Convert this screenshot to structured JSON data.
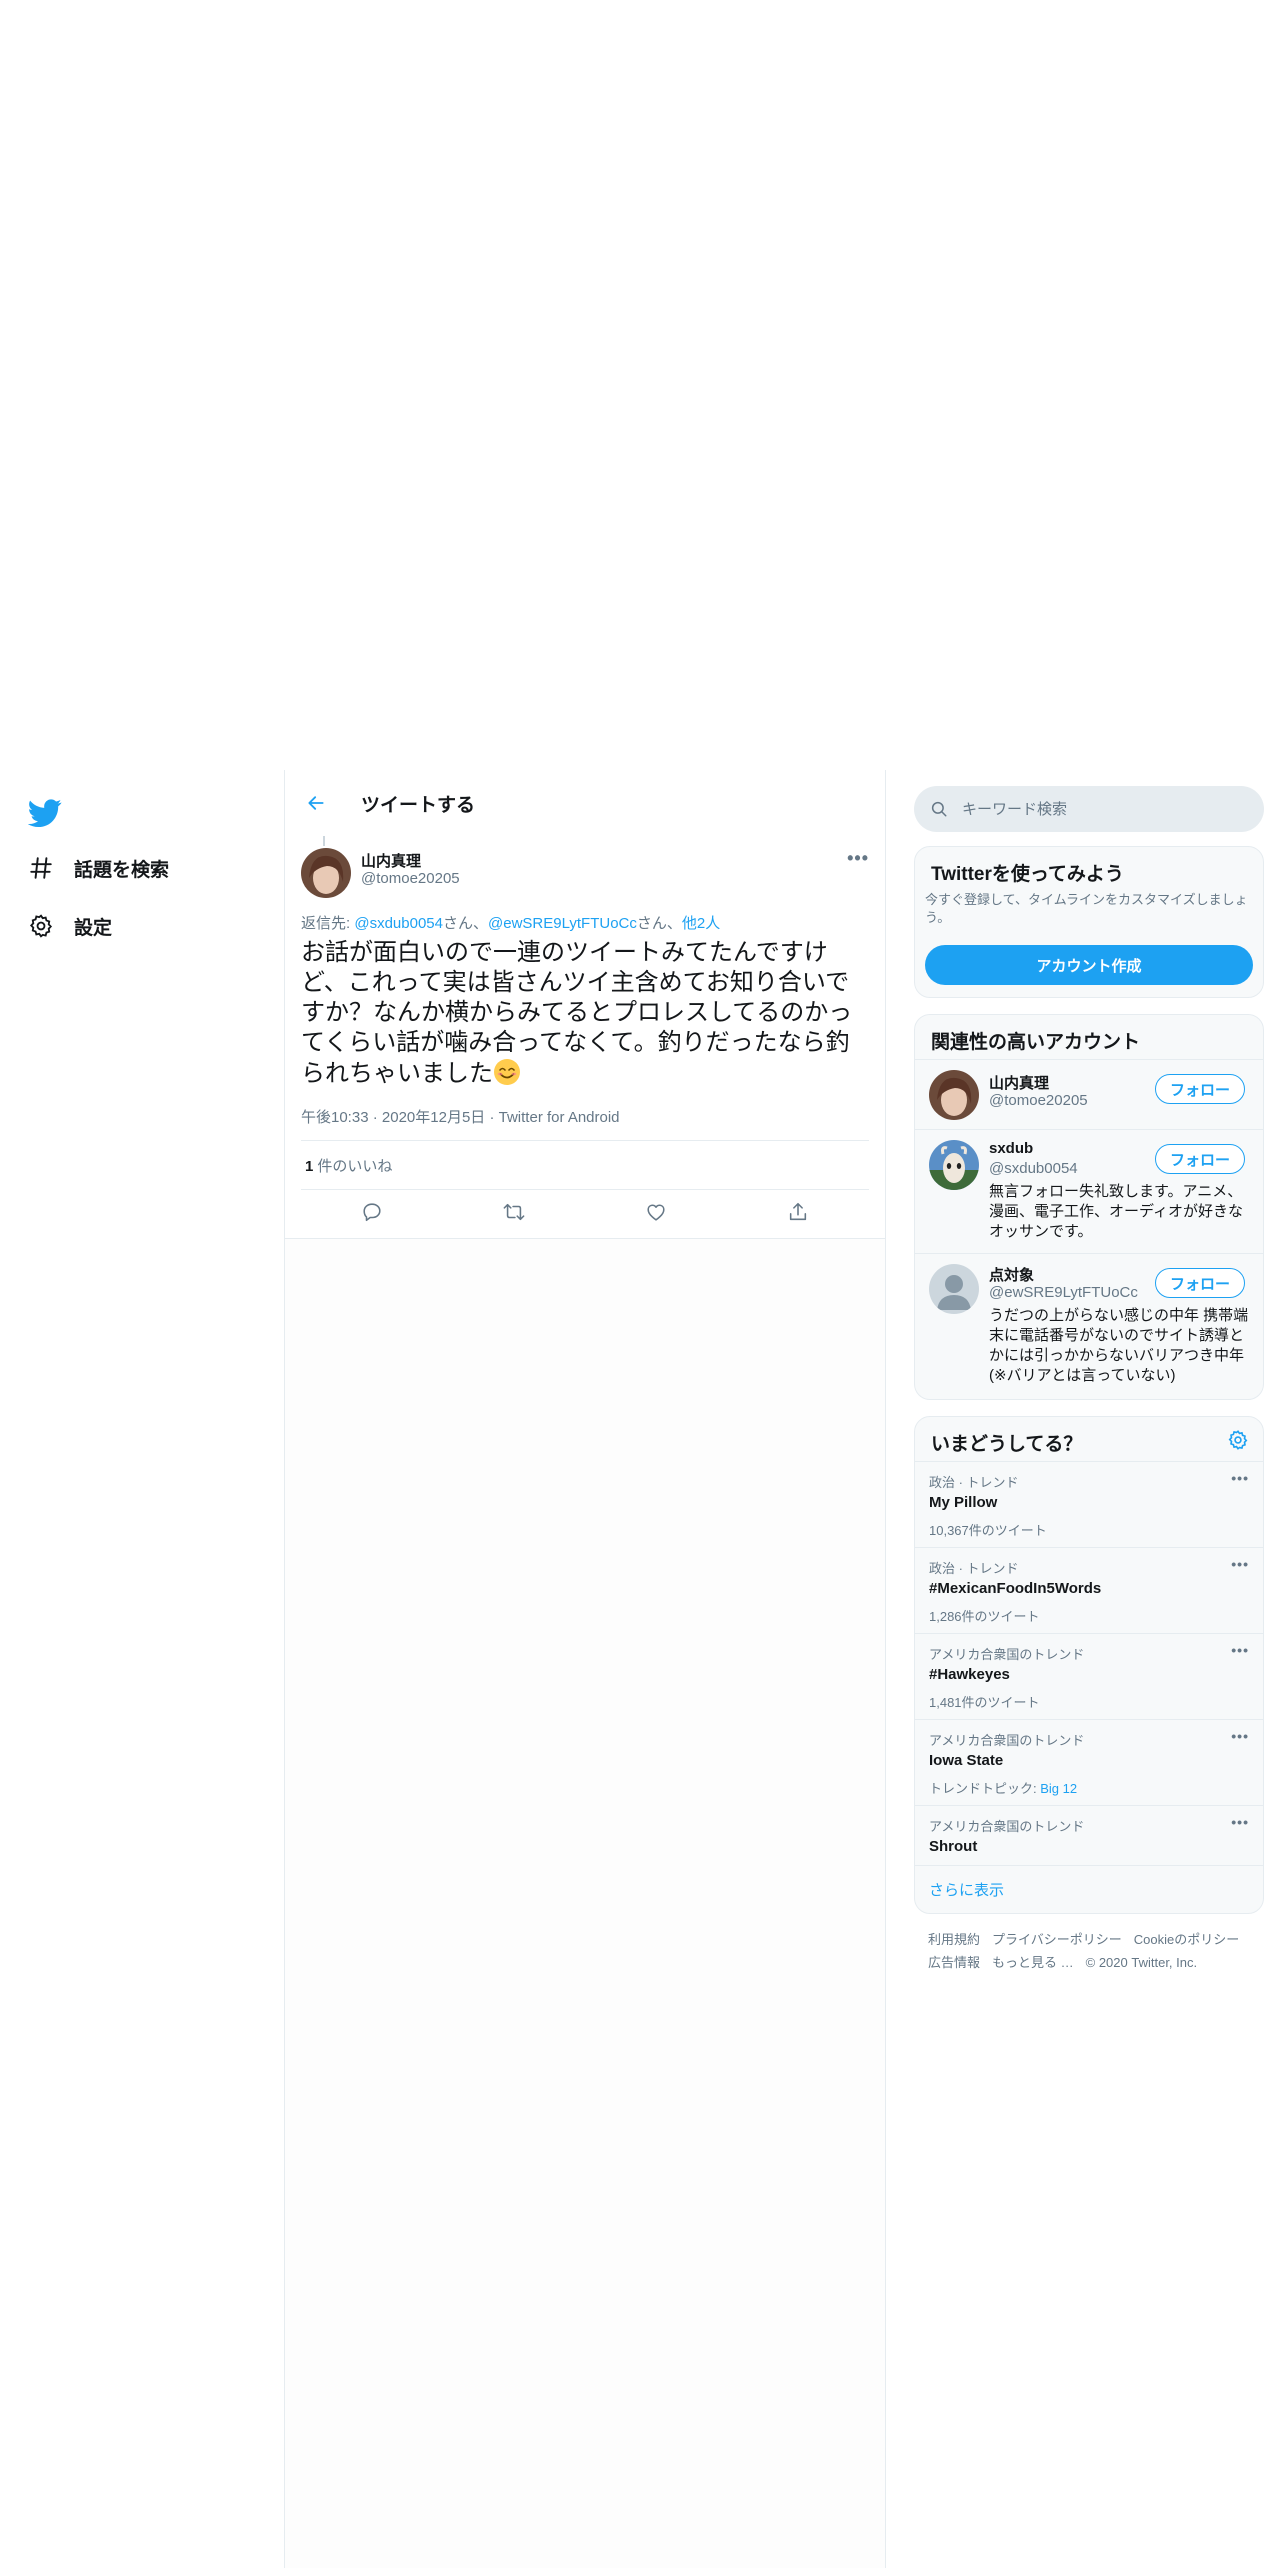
{
  "nav": {
    "items": [
      {
        "label": "話題を検索",
        "icon": "hashtag-icon"
      },
      {
        "label": "設定",
        "icon": "gear-icon"
      }
    ]
  },
  "header": {
    "title": "ツイートする"
  },
  "tweet": {
    "author_name": "山内真理",
    "author_handle": "@tomoe20205",
    "reply_prefix": "返信先: ",
    "reply_mentions": [
      "@sxdub0054",
      "@ewSRE9LytFTUoCc"
    ],
    "reply_suffix": "さん",
    "reply_separator": "、",
    "reply_others": "他2人",
    "text": "お話が面白いので一連のツイートみてたんですけど、これって実は皆さんツイ主含めてお知り合いですか？なんか横からみてるとプロレスしてるのかってくらい話が噛み合ってなくて。釣りだったなら釣られちゃいました",
    "emoji": "smiling-face-icon",
    "time": "午後10:33",
    "date": "2020年12月5日",
    "source": "Twitter for Android",
    "meta_sep": "·",
    "like_count": "1",
    "like_label": "件のいいね"
  },
  "sidebar": {
    "search_placeholder": "キーワード検索",
    "signup": {
      "title": "Twitterを使ってみよう",
      "description": "今すぐ登録して、タイムラインをカスタマイズしましょう。",
      "button": "アカウント作成"
    },
    "related": {
      "title": "関連性の高いアカウント",
      "follow_label": "フォロー",
      "accounts": [
        {
          "name": "山内真理",
          "handle": "@tomoe20205",
          "bio": ""
        },
        {
          "name": "sxdub",
          "handle": "@sxdub0054",
          "bio": "無言フォロー失礼致します。アニメ、漫画、電子工作、オーディオが好きなオッサンです。"
        },
        {
          "name": "点対象",
          "handle": "@ewSRE9LytFTUoCc",
          "bio": "うだつの上がらない感じの中年 携帯端末に電話番号がないのでサイト誘導とかには引っかからないバリアつき中年(※バリアとは言っていない)"
        }
      ]
    },
    "trends": {
      "title": "いまどうしてる？",
      "items": [
        {
          "context": "政治 · トレンド",
          "name": "My Pillow",
          "count": "10,367件のツイート"
        },
        {
          "context": "政治 · トレンド",
          "name": "#MexicanFoodIn5Words",
          "count": "1,286件のツイート"
        },
        {
          "context": "アメリカ合衆国のトレンド",
          "name": "#Hawkeyes",
          "count": "1,481件のツイート"
        },
        {
          "context": "アメリカ合衆国のトレンド",
          "name": "Iowa State",
          "topic_label": "トレンドトピック: ",
          "topic": "Big 12"
        },
        {
          "context": "アメリカ合衆国のトレンド",
          "name": "Shrout"
        }
      ],
      "show_more": "さらに表示"
    },
    "footer": {
      "links": [
        "利用規約",
        "プライバシーポリシー",
        "Cookieのポリシー",
        "広告情報",
        "もっと見る …"
      ],
      "copyright": "© 2020 Twitter, Inc."
    }
  },
  "colors": {
    "accent": "#1da1f2",
    "text": "#14171a",
    "secondary": "#657786",
    "border": "#e6ecf0"
  }
}
